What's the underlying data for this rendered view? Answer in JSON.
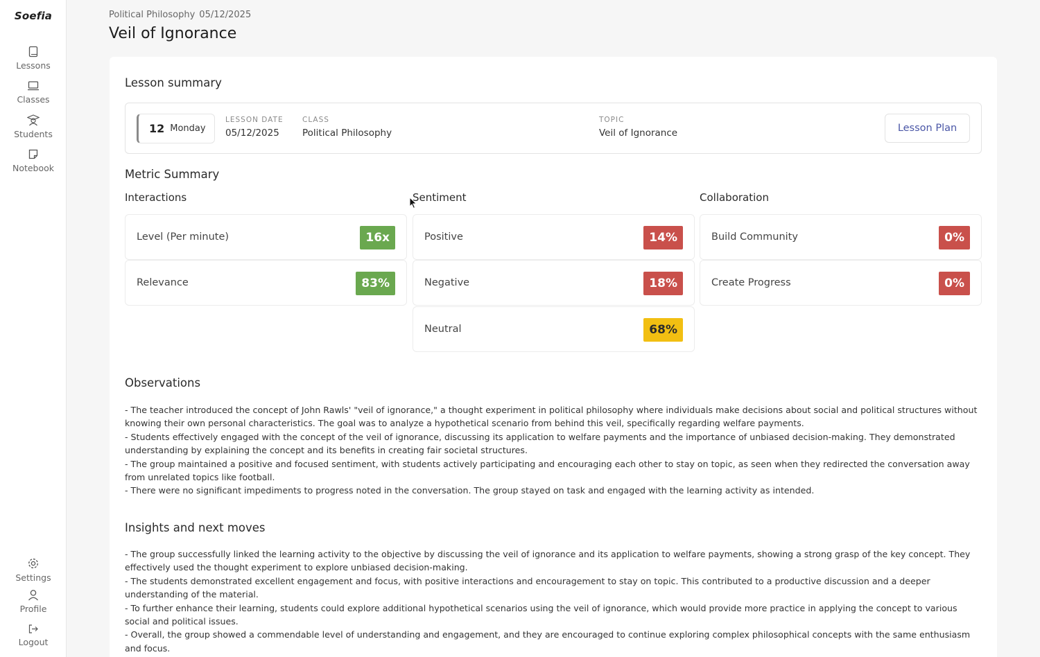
{
  "sidebar": {
    "logo": "Soefia",
    "items": [
      {
        "label": "Lessons",
        "icon": "book-icon"
      },
      {
        "label": "Classes",
        "icon": "laptop-icon"
      },
      {
        "label": "Students",
        "icon": "students-icon"
      },
      {
        "label": "Notebook",
        "icon": "notebook-icon"
      }
    ],
    "bottom_items": [
      {
        "label": "Settings",
        "icon": "gear-icon"
      },
      {
        "label": "Profile",
        "icon": "user-icon"
      },
      {
        "label": "Logout",
        "icon": "logout-icon"
      }
    ]
  },
  "header": {
    "breadcrumb_class": "Political Philosophy",
    "breadcrumb_date": "05/12/2025",
    "title": "Veil of Ignorance"
  },
  "lesson_summary": {
    "title": "Lesson summary",
    "day_number": "12",
    "weekday": "Monday",
    "lesson_date_label": "LESSON DATE",
    "lesson_date": "05/12/2025",
    "class_label": "CLASS",
    "class_value": "Political Philosophy",
    "topic_label": "TOPIC",
    "topic_value": "Veil of Ignorance",
    "lesson_plan_button": "Lesson Plan"
  },
  "metric_summary": {
    "title": "Metric Summary",
    "interactions": {
      "title": "Interactions",
      "items": [
        {
          "label": "Level (Per minute)",
          "value": "16x",
          "color": "#6aa84f"
        },
        {
          "label": "Relevance",
          "value": "83%",
          "color": "#6aa84f"
        }
      ]
    },
    "sentiment": {
      "title": "Sentiment",
      "items": [
        {
          "label": "Positive",
          "value": "14%",
          "color": "#c9504b"
        },
        {
          "label": "Negative",
          "value": "18%",
          "color": "#c9504b"
        },
        {
          "label": "Neutral",
          "value": "68%",
          "color": "#f2bf12"
        }
      ]
    },
    "collaboration": {
      "title": "Collaboration",
      "items": [
        {
          "label": "Build Community",
          "value": "0%",
          "color": "#c9504b"
        },
        {
          "label": "Create Progress",
          "value": "0%",
          "color": "#c9504b"
        }
      ]
    }
  },
  "observations": {
    "title": "Observations",
    "lines": [
      "- The teacher introduced the concept of John Rawls' \"veil of ignorance,\" a thought experiment in political philosophy where individuals make decisions about social and political structures without knowing their own personal characteristics. The goal was to analyze a hypothetical scenario from behind this veil, specifically regarding welfare payments.",
      "- Students effectively engaged with the concept of the veil of ignorance, discussing its application to welfare payments and the importance of unbiased decision-making. They demonstrated understanding by explaining the concept and its benefits in creating fair societal structures.",
      "- The group maintained a positive and focused sentiment, with students actively participating and encouraging each other to stay on topic, as seen when they redirected the conversation away from unrelated topics like football.",
      "- There were no significant impediments to progress noted in the conversation. The group stayed on task and engaged with the learning activity as intended."
    ]
  },
  "insights": {
    "title": "Insights and next moves",
    "lines": [
      "- The group successfully linked the learning activity to the objective by discussing the veil of ignorance and its application to welfare payments, showing a strong grasp of the key concept. They effectively used the thought experiment to explore unbiased decision-making.",
      "- The students demonstrated excellent engagement and focus, with positive interactions and encouragement to stay on topic. This contributed to a productive discussion and a deeper understanding of the material.",
      "- To further enhance their learning, students could explore additional hypothetical scenarios using the veil of ignorance, which would provide more practice in applying the concept to various social and political issues.",
      "- Overall, the group showed a commendable level of understanding and engagement, and they are encouraged to continue exploring complex philosophical concepts with the same enthusiasm and focus."
    ]
  }
}
